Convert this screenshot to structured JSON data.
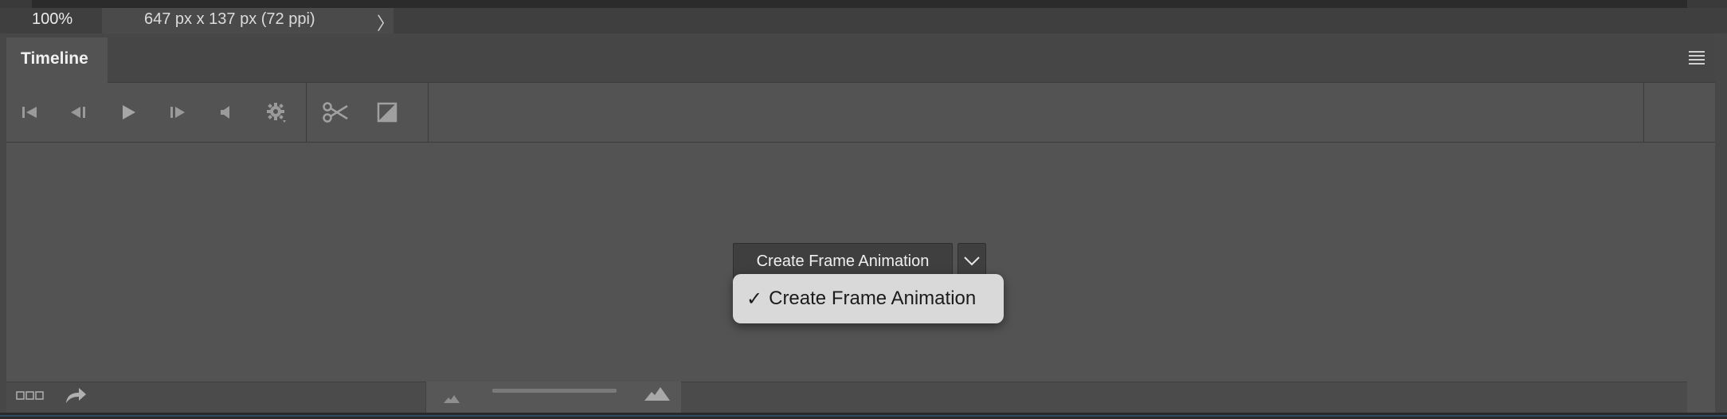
{
  "status_bar": {
    "zoom": "100%",
    "doc_info": "647 px x 137 px (72 ppi)",
    "expand_arrow": "〉"
  },
  "panel": {
    "tab_title": "Timeline",
    "menu_icon": "panel-menu-icon"
  },
  "toolbar": {
    "icons": [
      "go-to-first-frame-icon",
      "previous-frame-icon",
      "play-icon",
      "next-frame-icon",
      "audio-icon",
      "settings-icon",
      "scissors-icon",
      "transition-icon"
    ]
  },
  "create_button": {
    "label": "Create Frame Animation"
  },
  "dropdown": {
    "check": "✓",
    "item_label": "Create Frame Animation"
  },
  "bottom_bar": {
    "icons": [
      "convert-frames-icon",
      "redo-arrow-icon",
      "zoom-out-icon",
      "zoom-in-icon"
    ]
  },
  "colors": {
    "panel_bg": "#535353",
    "header_bg": "#464646",
    "menu_bg": "#d9d9d9"
  }
}
